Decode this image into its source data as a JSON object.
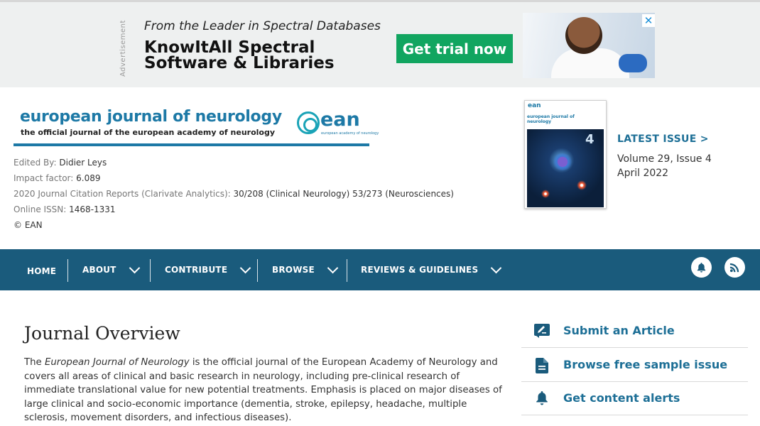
{
  "ad": {
    "label": "Advertisement",
    "tagline": "From the Leader in Spectral Databases",
    "title": "KnowItAll Spectral Software & Libraries",
    "cta": "Get trial now",
    "close": "✕",
    "cta_color": "#11a560"
  },
  "journal": {
    "name": "european journal of neurology",
    "subtitle": "the official journal of the european academy of neurology",
    "logo_word": "ean",
    "logo_small": "european academy of neurology",
    "brand_color": "#1d79a6"
  },
  "meta": {
    "edited_key": "Edited By:",
    "edited_val": "Didier Leys",
    "impact_key": "Impact factor:",
    "impact_val": "6.089",
    "jcr_key": "2020 Journal Citation Reports (Clarivate Analytics):",
    "jcr_val": "30/208 (Clinical Neurology)  53/273 (Neurosciences)",
    "issn_key": "Online ISSN:",
    "issn_val": "1468-1331",
    "copyright": "© EAN"
  },
  "cover": {
    "ean": "ean",
    "title": "european journal of neurology",
    "issue_num": "4"
  },
  "latest": {
    "label": "LATEST ISSUE  >",
    "volume": "Volume 29, Issue 4",
    "date": "April 2022"
  },
  "nav": {
    "home": "HOME",
    "about": "ABOUT",
    "contribute": "CONTRIBUTE",
    "browse": "BROWSE",
    "reviews": "REVIEWS & GUIDELINES",
    "bar_color": "#1a5b7c"
  },
  "overview": {
    "title": "Journal Overview",
    "intro_pre": "The ",
    "intro_em": "European Journal of Neurology",
    "intro_post": " is the official journal of the European Academy of Neurology and covers all areas of clinical and basic research in neurology, including pre-clinical research of immediate translational value for new potential treatments. Emphasis is placed on major diseases of large clinical and socio-economic importance (dementia, stroke, epilepsy, headache, multiple sclerosis, movement disorders, and infectious diseases)."
  },
  "actions": {
    "submit": "Submit an Article",
    "sample": "Browse free sample issue",
    "alerts": "Get content alerts"
  }
}
